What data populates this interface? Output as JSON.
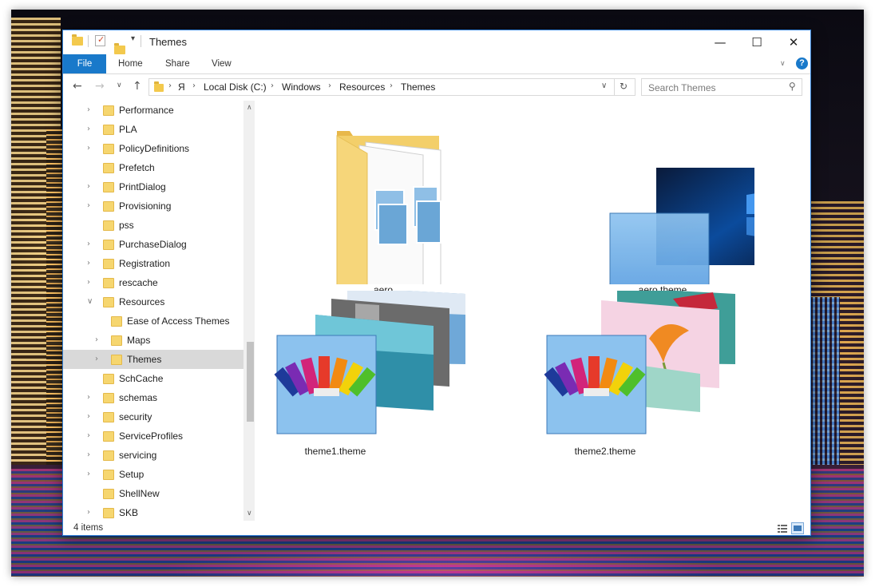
{
  "window": {
    "title": "Themes",
    "controls": {
      "minimize": "—",
      "maximize": "☐",
      "close": "✕"
    }
  },
  "ribbon": {
    "tabs": [
      "File",
      "Home",
      "Share",
      "View"
    ]
  },
  "address": {
    "crumbs": [
      "Я",
      "Local Disk (C:)",
      "Windows",
      "Resources",
      "Themes"
    ],
    "search_placeholder": "Search Themes"
  },
  "nav": {
    "items": [
      {
        "label": "Performance",
        "indent": 0,
        "expandable": true
      },
      {
        "label": "PLA",
        "indent": 0,
        "expandable": true
      },
      {
        "label": "PolicyDefinitions",
        "indent": 0,
        "expandable": true
      },
      {
        "label": "Prefetch",
        "indent": 0,
        "expandable": false
      },
      {
        "label": "PrintDialog",
        "indent": 0,
        "expandable": true
      },
      {
        "label": "Provisioning",
        "indent": 0,
        "expandable": true
      },
      {
        "label": "pss",
        "indent": 0,
        "expandable": false
      },
      {
        "label": "PurchaseDialog",
        "indent": 0,
        "expandable": true
      },
      {
        "label": "Registration",
        "indent": 0,
        "expandable": true
      },
      {
        "label": "rescache",
        "indent": 0,
        "expandable": true
      },
      {
        "label": "Resources",
        "indent": 0,
        "expandable": true,
        "expanded": true
      },
      {
        "label": "Ease of Access Themes",
        "indent": 1,
        "expandable": false
      },
      {
        "label": "Maps",
        "indent": 1,
        "expandable": true
      },
      {
        "label": "Themes",
        "indent": 1,
        "expandable": true,
        "selected": true
      },
      {
        "label": "SchCache",
        "indent": 0,
        "expandable": false
      },
      {
        "label": "schemas",
        "indent": 0,
        "expandable": true
      },
      {
        "label": "security",
        "indent": 0,
        "expandable": true
      },
      {
        "label": "ServiceProfiles",
        "indent": 0,
        "expandable": true
      },
      {
        "label": "servicing",
        "indent": 0,
        "expandable": true
      },
      {
        "label": "Setup",
        "indent": 0,
        "expandable": true
      },
      {
        "label": "ShellNew",
        "indent": 0,
        "expandable": false
      },
      {
        "label": "SKB",
        "indent": 0,
        "expandable": true
      }
    ]
  },
  "content": {
    "items": [
      {
        "name": "aero",
        "icon": "folder-icon"
      },
      {
        "name": "aero.theme",
        "icon": "windows-theme-icon"
      },
      {
        "name": "theme1.theme",
        "icon": "theme-pack-icon"
      },
      {
        "name": "theme2.theme",
        "icon": "theme-pack-icon"
      }
    ]
  },
  "status": {
    "item_count": "4 items"
  },
  "colors": {
    "accent": "#1979ca",
    "folder": "#f3c94d",
    "selection": "#d9d9d9"
  }
}
